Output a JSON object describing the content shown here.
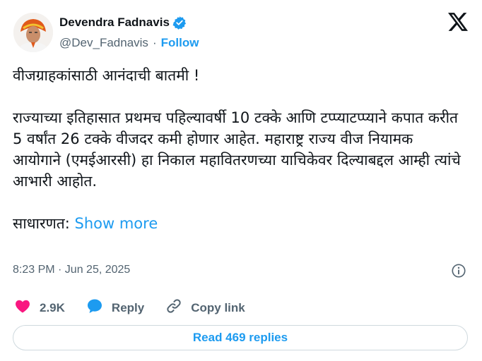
{
  "author": {
    "name": "Devendra Fadnavis",
    "handle": "@Dev_Fadnavis",
    "separator": "·",
    "follow_label": "Follow"
  },
  "tweet": {
    "line1": "वीजग्राहकांसाठी आनंदाची बातमी !",
    "line2": "राज्याच्या इतिहासात प्रथमच पहिल्यावर्षी 10 टक्के आणि टप्प्याटप्प्याने कपात करीत 5 वर्षांत 26 टक्के वीजदर कमी होणार आहेत. महाराष्ट्र राज्य वीज नियामक आयोगाने (एमईआरसी) हा निकाल महावितरणच्या याचिकेवर दिल्याबद्दल आम्ही त्यांचे आभारी आहोत.",
    "line3": "साधारणत:",
    "show_more": "Show more"
  },
  "meta": {
    "timestamp": "8:23 PM · Jun 25, 2025"
  },
  "actions": {
    "likes": "2.9K",
    "reply_label": "Reply",
    "copy_link_label": "Copy link"
  },
  "replies": {
    "label": "Read 469 replies"
  },
  "colors": {
    "accent": "#1d9bf0",
    "like": "#f91880",
    "text": "#0f1419",
    "muted": "#536471"
  },
  "icons": [
    "verified-badge-icon",
    "x-logo-icon",
    "info-icon",
    "heart-icon",
    "reply-bubble-icon",
    "link-icon"
  ]
}
